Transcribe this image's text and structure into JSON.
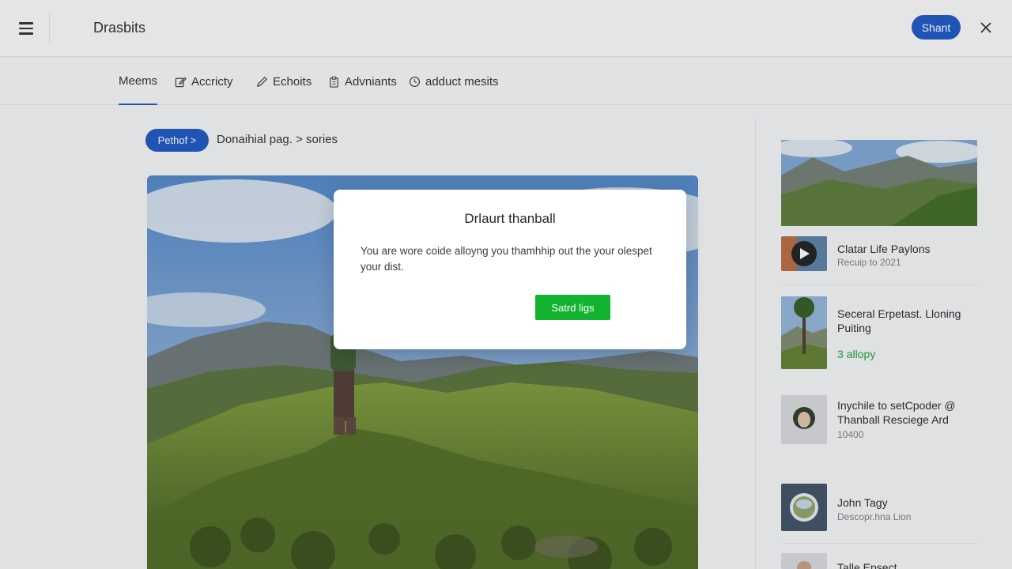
{
  "header": {
    "app_title": "Drasbits",
    "share_label": "Shant"
  },
  "tabs": [
    {
      "label": "Meems",
      "icon": "none"
    },
    {
      "label": "Accricty",
      "icon": "edit-icon"
    },
    {
      "label": "Echoits",
      "icon": "pencil-icon"
    },
    {
      "label": "Advniants",
      "icon": "clipboard-icon"
    },
    {
      "label": "adduct mesits",
      "icon": "clock-icon"
    }
  ],
  "breadcrumb": {
    "pill_label": "Pethof >",
    "path": "Donaihial pag. > sories"
  },
  "modal": {
    "title": "Drlaurt thanball",
    "body": "You are wore coide alloyng you thamhhip out the your olespet your dist.",
    "button_label": "Satrd ligs"
  },
  "sidebar": {
    "items": [
      {
        "title": "Clatar Life Paylons",
        "subtitle": "Recuip to 2021"
      },
      {
        "title": "Seceral Erpetast. Lloning Puiting",
        "highlight": "3 allopy"
      },
      {
        "title": "Inychile to setCpoder @ Thanball Resciege Ard",
        "subtitle": "10400"
      },
      {
        "title": "John Tagy",
        "subtitle": "Descopr.hna Lion"
      },
      {
        "title": "Talle Epsect"
      }
    ]
  },
  "colors": {
    "accent": "#1a56c4",
    "confirm": "#12b32e",
    "highlight_green": "#1aa33a"
  }
}
